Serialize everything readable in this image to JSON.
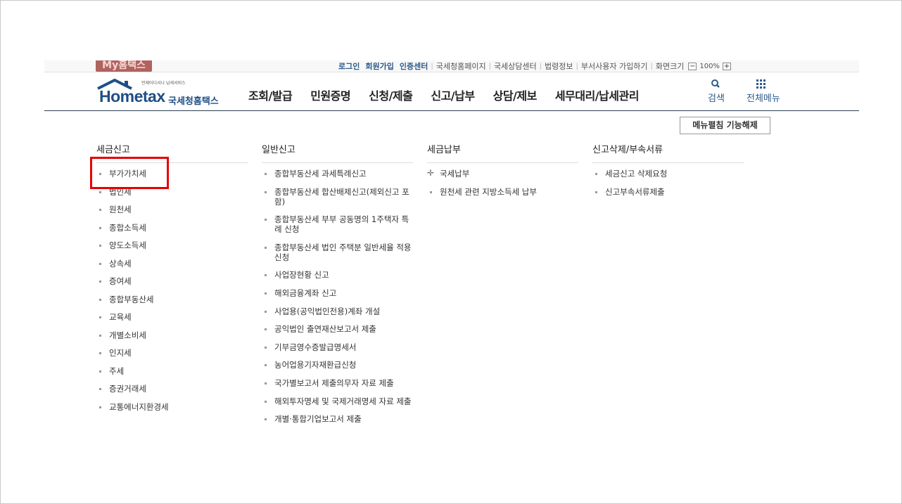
{
  "util": {
    "my_hometax": "My홈택스",
    "links": [
      {
        "label": "로그인",
        "strong": true
      },
      {
        "label": "회원가입",
        "strong": true
      },
      {
        "label": "인증센터",
        "strong": true
      },
      {
        "label": "국세청홈페이지",
        "strong": false
      },
      {
        "label": "국세상담센터",
        "strong": false
      },
      {
        "label": "법령정보",
        "strong": false
      },
      {
        "label": "부서사용자 가입하기",
        "strong": false
      },
      {
        "label": "화면크기",
        "strong": false
      }
    ],
    "zoom_minus": "−",
    "zoom_value": "100%",
    "zoom_plus": "+"
  },
  "header": {
    "logo_small": "언제어디서나 납세서비스",
    "logo_brand": "Hometax",
    "logo_kr": "국세청홈택스",
    "gnb": [
      "조회/발급",
      "민원증명",
      "신청/제출",
      "신고/납부",
      "상담/제보",
      "세무대리/납세관리"
    ],
    "search_label": "검색",
    "allmenu_label": "전체메뉴"
  },
  "close_button": "메뉴펼침 기능해제",
  "columns": [
    {
      "title": "세금신고",
      "items": [
        "부가가치세",
        "법인세",
        "원천세",
        "종합소득세",
        "양도소득세",
        "상속세",
        "증여세",
        "종합부동산세",
        "교육세",
        "개별소비세",
        "인지세",
        "주세",
        "증권거래세",
        "교통에너지환경세"
      ]
    },
    {
      "title": "일반신고",
      "items": [
        "종합부동산세 과세특례신고",
        "종합부동산세 합산배제신고(제외신고 포함)",
        "종합부동산세 부부 공동명의 1주택자 특례 신청",
        "종합부동산세 법인 주택분 일반세율 적용 신청",
        "사업장현황 신고",
        "해외금융계좌 신고",
        "사업용(공익법인전용)계좌 개설",
        "공익법인 출연재산보고서 제출",
        "기부금영수증발급명세서",
        "농어업용기자재환급신청",
        "국가별보고서 제출의무자 자료 제출",
        "해외투자명세 및 국제거래명세 자료 제출",
        "개별·통합기업보고서 제출"
      ]
    },
    {
      "title": "세금납부",
      "items": [
        "국세납부",
        "원천세 관련 지방소득세 납부"
      ]
    },
    {
      "title": "신고삭제/부속서류",
      "items": [
        "세금신고 삭제요청",
        "신고부속서류제출"
      ]
    }
  ],
  "colors": {
    "brand_blue": "#1f4f85",
    "my_hometax_bg": "#b0635f",
    "highlight": "#e60000"
  }
}
